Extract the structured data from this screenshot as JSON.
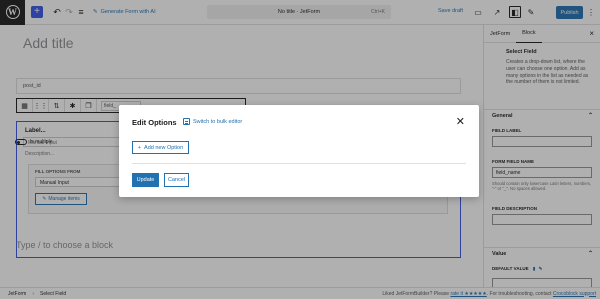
{
  "topbar": {
    "generate_label": "Generate Form with AI",
    "doc_title": "No title · JetForm",
    "shortcut": "Ctrl+K",
    "save_draft": "Save draft",
    "publish": "Publish"
  },
  "editor": {
    "title_placeholder": "Add title",
    "post_id_label": "post_id",
    "field_select": "field_",
    "select_block": {
      "label": "Label...",
      "input_placeholder": "Manual Input",
      "description": "Description...",
      "fill_options_title": "FILL OPTIONS FROM",
      "fill_options_value": "Manual Input",
      "manage_items": "Manage items",
      "is_multiple": "Is multiple"
    },
    "choose_block_placeholder": "Type / to choose a block"
  },
  "sidebar": {
    "tabs": [
      "JetForm",
      "Block"
    ],
    "active_tab": "Block",
    "block_name": "Select Field",
    "block_desc": "Creates a drop-down list, where the user can choose one option. Add as many options in the list as needed as the number of them is not limited.",
    "general": "General",
    "field_label": "FIELD LABEL",
    "form_field_name": "FORM FIELD NAME",
    "form_field_name_value": "field_name",
    "field_name_help": "Should contain only lowercase Latin letters, numbers, \"-\" or \"_\". No spaces allowed.",
    "field_description": "FIELD DESCRIPTION",
    "value": "Value",
    "default_value": "DEFAULT VALUE"
  },
  "statusbar": {
    "crumbs": [
      "JetForm",
      "Select Field"
    ],
    "footer_prefix": "Liked JetFormBuilder? Please ",
    "footer_rate": "rate it ★★★★★",
    "footer_mid": ". For troubleshooting, contact ",
    "footer_support": "Crocoblock support"
  },
  "modal": {
    "title": "Edit Options",
    "bulk_editor": "Switch to bulk editor",
    "add_option": "Add new Option",
    "update": "Update",
    "cancel": "Cancel"
  },
  "colors": {
    "accent": "#2271b1",
    "inserter": "#3858e9"
  }
}
